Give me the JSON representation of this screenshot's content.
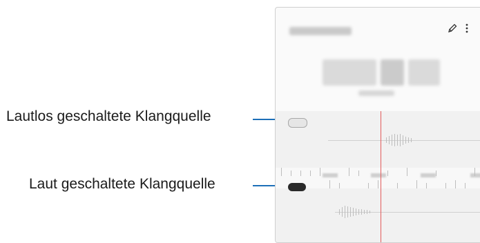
{
  "callouts": {
    "muted": "Lautlos geschaltete Klangquelle",
    "loud": "Laut geschaltete Klangquelle"
  },
  "recording": {
    "toolbar_icons": [
      "pencil-icon",
      "more-options-icon"
    ]
  },
  "colors": {
    "leader": "#1c6fb8",
    "playhead": "#e25b5b",
    "loud_toggle": "#2a2a2a"
  }
}
